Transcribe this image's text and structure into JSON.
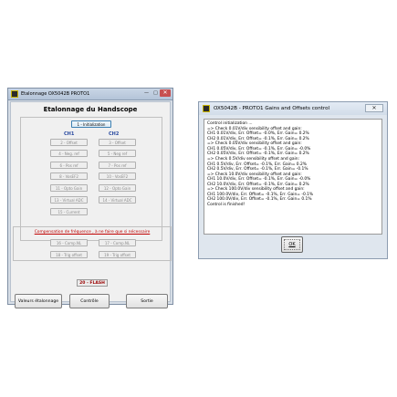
{
  "window1": {
    "title": "Etalonnage  OX5042B  PROTO1",
    "minimize": "—",
    "maximize": "□",
    "close": "✕",
    "heading": "Etalonnage du Handscope",
    "init_button": "1 - Initialization",
    "ch1_header": "CH1",
    "ch2_header": "CH2",
    "left_buttons": [
      "2 - Offset",
      "4 - Neg. ref",
      "6 - Pos ref",
      "8 - VosEF2",
      "11 - Opto Gain",
      "13 - Virtual ADC",
      "15 - Current"
    ],
    "right_buttons": [
      "3 - Offset",
      "5 - Neg ref",
      "7 - Pos ref",
      "10 - VosEF2",
      "12 - Opto Gain",
      "14 - Virtual ADC"
    ],
    "compensation_text": "Compensation de fréquence ,  à ne faire que si nécessaire",
    "comp_buttons_row1": [
      "16 - Comp.NL",
      "17 - Comp.NL"
    ],
    "comp_buttons_row2": [
      "18 - Trig offset",
      "19 - Trig offset"
    ],
    "flash_label": "20 - FLASH",
    "bottom_buttons": [
      "Valeurs étalonnage",
      "Contrôle",
      "Sortie"
    ]
  },
  "window2": {
    "title": "OX5042B - PROTO1 Gains and Offsets control",
    "close": "✕",
    "log_lines": [
      "Control initialization ...",
      "=> Check 0.01V/div sensibility offset and gain:",
      "CH1  0.01V/div,  Err. Offset= -0.0%,  Err. Gain= 0.2%",
      "CH2  0.01V/div,  Err. Offset= -0.1%,  Err. Gain= 0.2%",
      "=> Check 0.05V/div sensibility offset and gain:",
      "CH1  0.05V/div,  Err. Offset= -0.1%,  Err. Gain= -0.0%",
      "CH2  0.05V/div,  Err. Offset= -0.1%,  Err. Gain= 0.2%",
      "=> Check 0.5V/div sensibility offset and gain:",
      "CH1  0.5V/div,  Err. Offset= -0.1%,  Err. Gain= 0.2%",
      "CH2  0.5V/div,  Err. Offset= -0.1%,  Err. Gain= -0.1%",
      "=> Check 10.0V/div sensibility offset and gain:",
      "CH1  10.0V/div,  Err. Offset= -0.1%,  Err. Gain= -0.0%",
      "CH2  10.0V/div,  Err. Offset= -0.1%,  Err. Gain= 0.2%",
      "=> Check 100.0V/div sensibility offset and gain:",
      "CH1  100.0V/div,  Err. Offset= -0.1%,  Err. Gain= -0.1%",
      "CH2  100.0V/div,  Err. Offset= -0.1%,  Err. Gain= 0.1%",
      "Control is finished!"
    ],
    "ok_button": "OK"
  }
}
